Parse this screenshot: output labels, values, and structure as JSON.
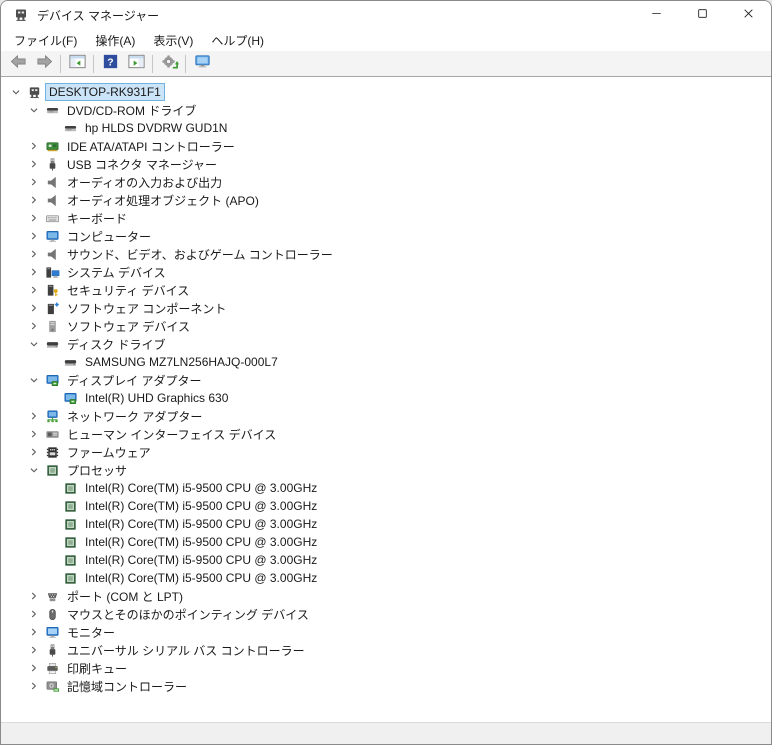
{
  "window": {
    "title": "デバイス マネージャー"
  },
  "window_controls": {
    "buttons": [
      {
        "id": "minimize",
        "icon": "minimize-icon"
      },
      {
        "id": "maximize",
        "icon": "maximize-icon"
      },
      {
        "id": "close",
        "icon": "close-icon"
      }
    ]
  },
  "menu": {
    "items": [
      {
        "id": "file",
        "label": "ファイル(F)"
      },
      {
        "id": "action",
        "label": "操作(A)"
      },
      {
        "id": "view",
        "label": "表示(V)"
      },
      {
        "id": "help",
        "label": "ヘルプ(H)"
      }
    ]
  },
  "toolbar": {
    "buttons": [
      {
        "id": "back",
        "icon": "back-icon"
      },
      {
        "id": "forward",
        "icon": "forward-icon"
      },
      {
        "separator": true
      },
      {
        "id": "show-console-tree",
        "icon": "console-tree-icon"
      },
      {
        "separator": true
      },
      {
        "id": "help",
        "icon": "help-icon"
      },
      {
        "id": "show-action-pane",
        "icon": "action-pane-icon"
      },
      {
        "separator": true
      },
      {
        "id": "scan-hardware-changes",
        "icon": "scan-icon"
      },
      {
        "separator": true
      },
      {
        "id": "remote-computer",
        "icon": "remote-monitor-icon"
      }
    ]
  },
  "tree": {
    "rows": [
      {
        "level": 0,
        "state": "expanded",
        "icon": "workstation-icon",
        "label": "DESKTOP-RK931F1",
        "selected": true
      },
      {
        "level": 1,
        "state": "expanded",
        "icon": "disc-drive-icon",
        "label": "DVD/CD-ROM ドライブ"
      },
      {
        "level": 2,
        "state": null,
        "icon": "disc-drive-icon",
        "label": "hp HLDS DVDRW GUD1N"
      },
      {
        "level": 1,
        "state": "collapsed",
        "icon": "ide-icon",
        "label": "IDE ATA/ATAPI コントローラー"
      },
      {
        "level": 1,
        "state": "collapsed",
        "icon": "usb-icon",
        "label": "USB コネクタ マネージャー"
      },
      {
        "level": 1,
        "state": "collapsed",
        "icon": "audio-icon",
        "label": "オーディオの入力および出力"
      },
      {
        "level": 1,
        "state": "collapsed",
        "icon": "audio-icon",
        "label": "オーディオ処理オブジェクト (APO)"
      },
      {
        "level": 1,
        "state": "collapsed",
        "icon": "keyboard-icon",
        "label": "キーボード"
      },
      {
        "level": 1,
        "state": "collapsed",
        "icon": "computer-icon",
        "label": "コンピューター"
      },
      {
        "level": 1,
        "state": "collapsed",
        "icon": "audio-icon",
        "label": "サウンド、ビデオ、およびゲーム コントローラー"
      },
      {
        "level": 1,
        "state": "collapsed",
        "icon": "system-icon",
        "label": "システム デバイス"
      },
      {
        "level": 1,
        "state": "collapsed",
        "icon": "security-icon",
        "label": "セキュリティ デバイス"
      },
      {
        "level": 1,
        "state": "collapsed",
        "icon": "sw-component-icon",
        "label": "ソフトウェア コンポーネント"
      },
      {
        "level": 1,
        "state": "collapsed",
        "icon": "sw-device-icon",
        "label": "ソフトウェア デバイス"
      },
      {
        "level": 1,
        "state": "expanded",
        "icon": "disk-icon",
        "label": "ディスク ドライブ"
      },
      {
        "level": 2,
        "state": null,
        "icon": "disk-icon",
        "label": "SAMSUNG MZ7LN256HAJQ-000L7"
      },
      {
        "level": 1,
        "state": "expanded",
        "icon": "display-icon",
        "label": "ディスプレイ アダプター"
      },
      {
        "level": 2,
        "state": null,
        "icon": "display-icon",
        "label": "Intel(R) UHD Graphics 630"
      },
      {
        "level": 1,
        "state": "collapsed",
        "icon": "network-icon",
        "label": "ネットワーク アダプター"
      },
      {
        "level": 1,
        "state": "collapsed",
        "icon": "hid-icon",
        "label": "ヒューマン インターフェイス デバイス"
      },
      {
        "level": 1,
        "state": "collapsed",
        "icon": "firmware-icon",
        "label": "ファームウェア"
      },
      {
        "level": 1,
        "state": "expanded",
        "icon": "cpu-icon",
        "label": "プロセッサ"
      },
      {
        "level": 2,
        "state": null,
        "icon": "cpu-icon",
        "label": "Intel(R) Core(TM) i5-9500 CPU @ 3.00GHz"
      },
      {
        "level": 2,
        "state": null,
        "icon": "cpu-icon",
        "label": "Intel(R) Core(TM) i5-9500 CPU @ 3.00GHz"
      },
      {
        "level": 2,
        "state": null,
        "icon": "cpu-icon",
        "label": "Intel(R) Core(TM) i5-9500 CPU @ 3.00GHz"
      },
      {
        "level": 2,
        "state": null,
        "icon": "cpu-icon",
        "label": "Intel(R) Core(TM) i5-9500 CPU @ 3.00GHz"
      },
      {
        "level": 2,
        "state": null,
        "icon": "cpu-icon",
        "label": "Intel(R) Core(TM) i5-9500 CPU @ 3.00GHz"
      },
      {
        "level": 2,
        "state": null,
        "icon": "cpu-icon",
        "label": "Intel(R) Core(TM) i5-9500 CPU @ 3.00GHz"
      },
      {
        "level": 1,
        "state": "collapsed",
        "icon": "port-icon",
        "label": "ポート (COM と LPT)"
      },
      {
        "level": 1,
        "state": "collapsed",
        "icon": "mouse-icon",
        "label": "マウスとそのほかのポインティング デバイス"
      },
      {
        "level": 1,
        "state": "collapsed",
        "icon": "monitor-icon",
        "label": "モニター"
      },
      {
        "level": 1,
        "state": "collapsed",
        "icon": "usb-icon",
        "label": "ユニバーサル シリアル バス コントローラー"
      },
      {
        "level": 1,
        "state": "collapsed",
        "icon": "printer-icon",
        "label": "印刷キュー"
      },
      {
        "level": 1,
        "state": "collapsed",
        "icon": "storage-icon",
        "label": "記憶域コントローラー"
      }
    ]
  },
  "colors": {
    "selection_bg": "#cce4f7",
    "selection_border": "#70b3e0",
    "toolbar_bg": "#f4f4f4",
    "titlebar_bg": "#ffffff",
    "status_bg": "#f0f0f0",
    "accent_blue": "#2d7dd2",
    "accent_green": "#3f9c35"
  }
}
